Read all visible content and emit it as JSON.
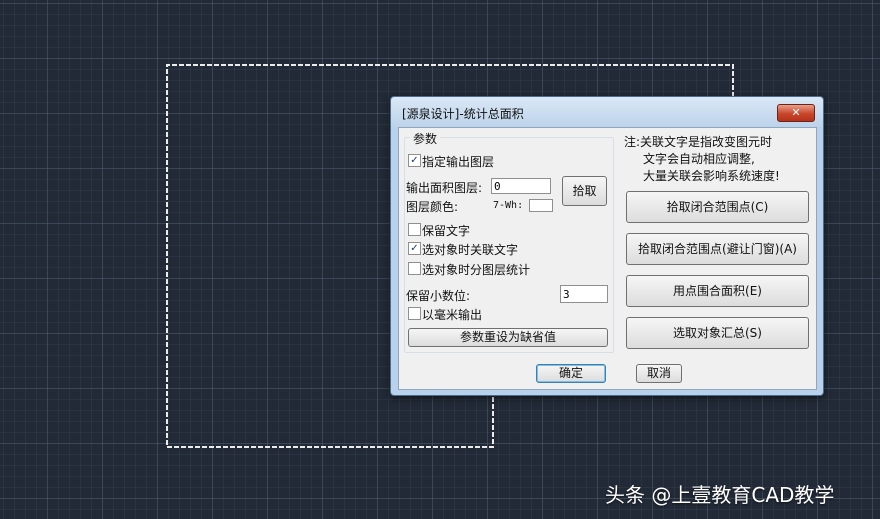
{
  "dialog": {
    "title": "[源泉设计]-统计总面积",
    "close_glyph": "✕",
    "params": {
      "legend": "参数",
      "specify_layer": {
        "label": "指定输出图层",
        "checked": true
      },
      "area_layer_label": "输出面积图层:",
      "area_layer_value": "0",
      "pick_button": "拾取",
      "layer_color_label": "图层颜色:",
      "layer_color_value": "7-Wh:",
      "keep_text": {
        "label": "保留文字",
        "checked": false
      },
      "link_text": {
        "label": "选对象时关联文字",
        "checked": true
      },
      "by_layer": {
        "label": "选对象时分图层统计",
        "checked": false
      },
      "decimals_label": "保留小数位:",
      "decimals_value": "3",
      "mm_output": {
        "label": "以毫米输出",
        "checked": false
      },
      "reset_button": "参数重设为缺省值"
    },
    "note_lines": [
      "注:关联文字是指改变图元时",
      "文字会自动相应调整,",
      "大量关联会影响系统速度!"
    ],
    "actions": [
      "拾取闭合范围点(C)",
      "拾取闭合范围点(避让门窗)(A)",
      "用点围合面积(E)",
      "选取对象汇总(S)"
    ],
    "ok_button": "确定",
    "cancel_button": "取消"
  },
  "watermark": "头条 @上壹教育CAD教学"
}
